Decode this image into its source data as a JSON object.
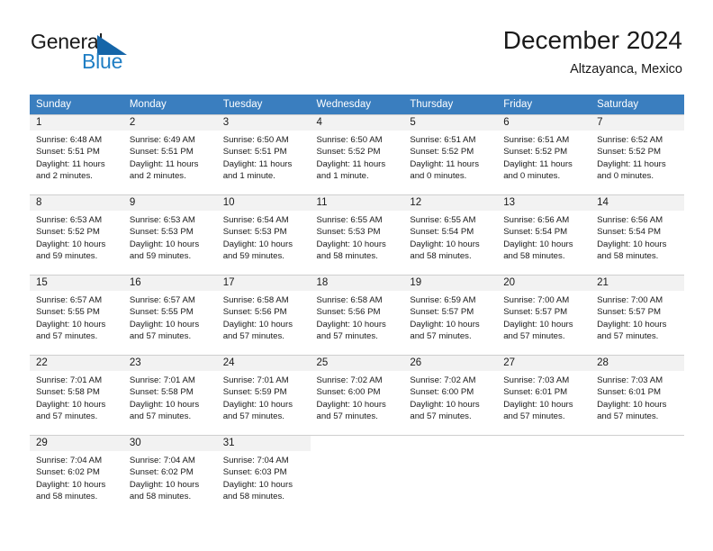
{
  "brand": {
    "word_one": "General",
    "word_two": "Blue",
    "mark": "triangle-icon",
    "accent": "#1f7ec4",
    "mark_color": "#1565a8"
  },
  "header": {
    "title": "December 2024",
    "subtitle": "Altzayanca, Mexico"
  },
  "theme": {
    "header_bar": "#3a7ebf",
    "daynum_band": "#f2f2f2",
    "grid_line": "#cfcfcf",
    "text": "#1a1a1a"
  },
  "weekday_headers": [
    "Sunday",
    "Monday",
    "Tuesday",
    "Wednesday",
    "Thursday",
    "Friday",
    "Saturday"
  ],
  "weeks": [
    [
      {
        "day": "1",
        "sunrise": "Sunrise: 6:48 AM",
        "sunset": "Sunset: 5:51 PM",
        "daylight1": "Daylight: 11 hours",
        "daylight2": "and 2 minutes."
      },
      {
        "day": "2",
        "sunrise": "Sunrise: 6:49 AM",
        "sunset": "Sunset: 5:51 PM",
        "daylight1": "Daylight: 11 hours",
        "daylight2": "and 2 minutes."
      },
      {
        "day": "3",
        "sunrise": "Sunrise: 6:50 AM",
        "sunset": "Sunset: 5:51 PM",
        "daylight1": "Daylight: 11 hours",
        "daylight2": "and 1 minute."
      },
      {
        "day": "4",
        "sunrise": "Sunrise: 6:50 AM",
        "sunset": "Sunset: 5:52 PM",
        "daylight1": "Daylight: 11 hours",
        "daylight2": "and 1 minute."
      },
      {
        "day": "5",
        "sunrise": "Sunrise: 6:51 AM",
        "sunset": "Sunset: 5:52 PM",
        "daylight1": "Daylight: 11 hours",
        "daylight2": "and 0 minutes."
      },
      {
        "day": "6",
        "sunrise": "Sunrise: 6:51 AM",
        "sunset": "Sunset: 5:52 PM",
        "daylight1": "Daylight: 11 hours",
        "daylight2": "and 0 minutes."
      },
      {
        "day": "7",
        "sunrise": "Sunrise: 6:52 AM",
        "sunset": "Sunset: 5:52 PM",
        "daylight1": "Daylight: 11 hours",
        "daylight2": "and 0 minutes."
      }
    ],
    [
      {
        "day": "8",
        "sunrise": "Sunrise: 6:53 AM",
        "sunset": "Sunset: 5:52 PM",
        "daylight1": "Daylight: 10 hours",
        "daylight2": "and 59 minutes."
      },
      {
        "day": "9",
        "sunrise": "Sunrise: 6:53 AM",
        "sunset": "Sunset: 5:53 PM",
        "daylight1": "Daylight: 10 hours",
        "daylight2": "and 59 minutes."
      },
      {
        "day": "10",
        "sunrise": "Sunrise: 6:54 AM",
        "sunset": "Sunset: 5:53 PM",
        "daylight1": "Daylight: 10 hours",
        "daylight2": "and 59 minutes."
      },
      {
        "day": "11",
        "sunrise": "Sunrise: 6:55 AM",
        "sunset": "Sunset: 5:53 PM",
        "daylight1": "Daylight: 10 hours",
        "daylight2": "and 58 minutes."
      },
      {
        "day": "12",
        "sunrise": "Sunrise: 6:55 AM",
        "sunset": "Sunset: 5:54 PM",
        "daylight1": "Daylight: 10 hours",
        "daylight2": "and 58 minutes."
      },
      {
        "day": "13",
        "sunrise": "Sunrise: 6:56 AM",
        "sunset": "Sunset: 5:54 PM",
        "daylight1": "Daylight: 10 hours",
        "daylight2": "and 58 minutes."
      },
      {
        "day": "14",
        "sunrise": "Sunrise: 6:56 AM",
        "sunset": "Sunset: 5:54 PM",
        "daylight1": "Daylight: 10 hours",
        "daylight2": "and 58 minutes."
      }
    ],
    [
      {
        "day": "15",
        "sunrise": "Sunrise: 6:57 AM",
        "sunset": "Sunset: 5:55 PM",
        "daylight1": "Daylight: 10 hours",
        "daylight2": "and 57 minutes."
      },
      {
        "day": "16",
        "sunrise": "Sunrise: 6:57 AM",
        "sunset": "Sunset: 5:55 PM",
        "daylight1": "Daylight: 10 hours",
        "daylight2": "and 57 minutes."
      },
      {
        "day": "17",
        "sunrise": "Sunrise: 6:58 AM",
        "sunset": "Sunset: 5:56 PM",
        "daylight1": "Daylight: 10 hours",
        "daylight2": "and 57 minutes."
      },
      {
        "day": "18",
        "sunrise": "Sunrise: 6:58 AM",
        "sunset": "Sunset: 5:56 PM",
        "daylight1": "Daylight: 10 hours",
        "daylight2": "and 57 minutes."
      },
      {
        "day": "19",
        "sunrise": "Sunrise: 6:59 AM",
        "sunset": "Sunset: 5:57 PM",
        "daylight1": "Daylight: 10 hours",
        "daylight2": "and 57 minutes."
      },
      {
        "day": "20",
        "sunrise": "Sunrise: 7:00 AM",
        "sunset": "Sunset: 5:57 PM",
        "daylight1": "Daylight: 10 hours",
        "daylight2": "and 57 minutes."
      },
      {
        "day": "21",
        "sunrise": "Sunrise: 7:00 AM",
        "sunset": "Sunset: 5:57 PM",
        "daylight1": "Daylight: 10 hours",
        "daylight2": "and 57 minutes."
      }
    ],
    [
      {
        "day": "22",
        "sunrise": "Sunrise: 7:01 AM",
        "sunset": "Sunset: 5:58 PM",
        "daylight1": "Daylight: 10 hours",
        "daylight2": "and 57 minutes."
      },
      {
        "day": "23",
        "sunrise": "Sunrise: 7:01 AM",
        "sunset": "Sunset: 5:58 PM",
        "daylight1": "Daylight: 10 hours",
        "daylight2": "and 57 minutes."
      },
      {
        "day": "24",
        "sunrise": "Sunrise: 7:01 AM",
        "sunset": "Sunset: 5:59 PM",
        "daylight1": "Daylight: 10 hours",
        "daylight2": "and 57 minutes."
      },
      {
        "day": "25",
        "sunrise": "Sunrise: 7:02 AM",
        "sunset": "Sunset: 6:00 PM",
        "daylight1": "Daylight: 10 hours",
        "daylight2": "and 57 minutes."
      },
      {
        "day": "26",
        "sunrise": "Sunrise: 7:02 AM",
        "sunset": "Sunset: 6:00 PM",
        "daylight1": "Daylight: 10 hours",
        "daylight2": "and 57 minutes."
      },
      {
        "day": "27",
        "sunrise": "Sunrise: 7:03 AM",
        "sunset": "Sunset: 6:01 PM",
        "daylight1": "Daylight: 10 hours",
        "daylight2": "and 57 minutes."
      },
      {
        "day": "28",
        "sunrise": "Sunrise: 7:03 AM",
        "sunset": "Sunset: 6:01 PM",
        "daylight1": "Daylight: 10 hours",
        "daylight2": "and 57 minutes."
      }
    ],
    [
      {
        "day": "29",
        "sunrise": "Sunrise: 7:04 AM",
        "sunset": "Sunset: 6:02 PM",
        "daylight1": "Daylight: 10 hours",
        "daylight2": "and 58 minutes."
      },
      {
        "day": "30",
        "sunrise": "Sunrise: 7:04 AM",
        "sunset": "Sunset: 6:02 PM",
        "daylight1": "Daylight: 10 hours",
        "daylight2": "and 58 minutes."
      },
      {
        "day": "31",
        "sunrise": "Sunrise: 7:04 AM",
        "sunset": "Sunset: 6:03 PM",
        "daylight1": "Daylight: 10 hours",
        "daylight2": "and 58 minutes."
      },
      {
        "day": "",
        "sunrise": "",
        "sunset": "",
        "daylight1": "",
        "daylight2": ""
      },
      {
        "day": "",
        "sunrise": "",
        "sunset": "",
        "daylight1": "",
        "daylight2": ""
      },
      {
        "day": "",
        "sunrise": "",
        "sunset": "",
        "daylight1": "",
        "daylight2": ""
      },
      {
        "day": "",
        "sunrise": "",
        "sunset": "",
        "daylight1": "",
        "daylight2": ""
      }
    ]
  ]
}
